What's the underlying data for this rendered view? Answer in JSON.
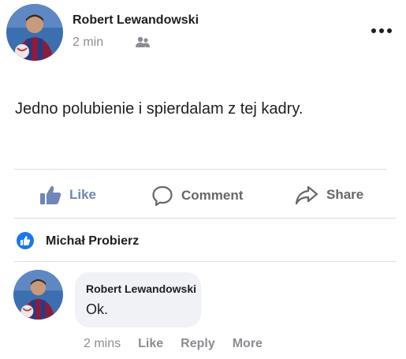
{
  "post": {
    "author": "Robert Lewandowski",
    "time": "2 min",
    "audience_icon": "friends-icon",
    "more_icon": "more-options-icon",
    "text": "Jedno polubienie i spierdalam z tej kadry."
  },
  "actions": {
    "like": "Like",
    "comment": "Comment",
    "share": "Share"
  },
  "reactions": {
    "icon": "like-reaction-icon",
    "name": "Michał Probierz"
  },
  "comment": {
    "author": "Robert Lewandowski",
    "text": "Ok.",
    "time": "2 mins",
    "like": "Like",
    "reply": "Reply",
    "more": "More"
  },
  "colors": {
    "accent": "#1877f2",
    "muted": "#65676b",
    "bubble": "#f0f2f5"
  }
}
